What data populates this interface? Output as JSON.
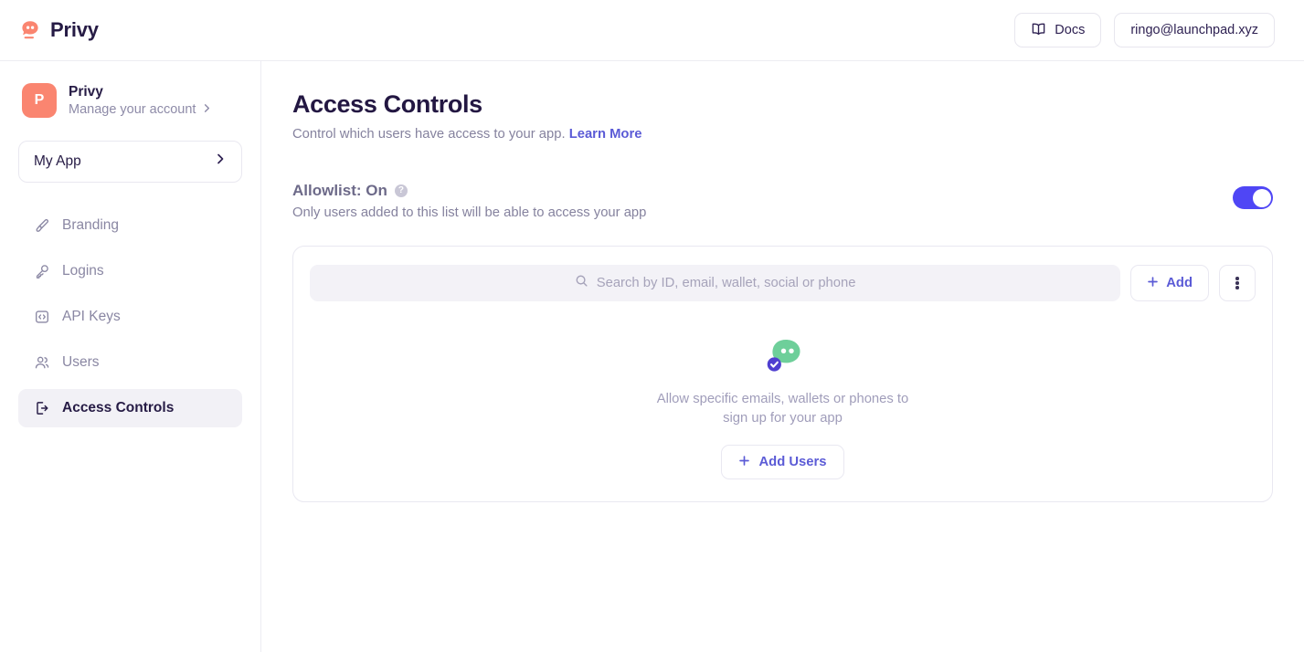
{
  "header": {
    "brand_name": "Privy",
    "docs_label": "Docs",
    "account_email": "ringo@launchpad.xyz"
  },
  "sidebar": {
    "account": {
      "avatar_initial": "P",
      "title": "Privy",
      "subtitle": "Manage your account"
    },
    "app_selector": {
      "label": "My App"
    },
    "items": [
      {
        "label": "Branding",
        "icon": "brush-icon",
        "active": false
      },
      {
        "label": "Logins",
        "icon": "key-icon",
        "active": false
      },
      {
        "label": "API Keys",
        "icon": "code-square-icon",
        "active": false
      },
      {
        "label": "Users",
        "icon": "users-icon",
        "active": false
      },
      {
        "label": "Access Controls",
        "icon": "door-exit-icon",
        "active": true
      }
    ]
  },
  "main": {
    "title": "Access Controls",
    "subtitle": "Control which users have access to your app.",
    "subtitle_link": "Learn More",
    "allowlist": {
      "title": "Allowlist: On",
      "description": "Only users added to this list will be able to access your app",
      "toggle_on": true
    },
    "card": {
      "search_placeholder": "Search by ID, email, wallet, social or phone",
      "search_value": "",
      "add_label": "Add",
      "empty_line1": "Allow specific emails, wallets or phones to",
      "empty_line2": "sign up for your app",
      "add_users_label": "Add Users"
    }
  },
  "colors": {
    "accent": "#5b5bd6",
    "toggle_on": "#4f46f5",
    "brand_coral": "#FA8570",
    "ink": "#261B45",
    "muted": "#85829e",
    "empty_art_green": "#6ecf9a",
    "empty_art_badge": "#4f3fd0"
  }
}
